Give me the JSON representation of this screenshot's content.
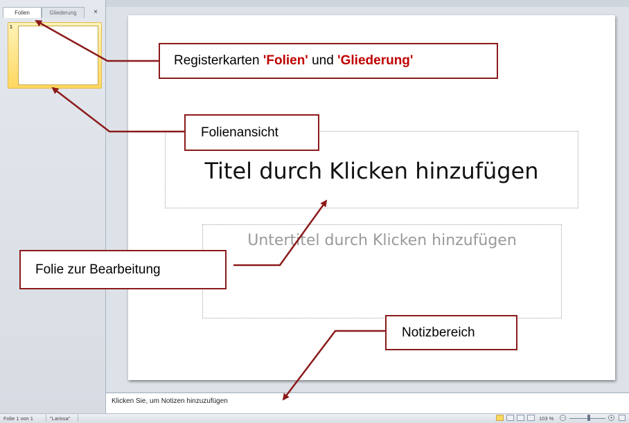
{
  "left_panel": {
    "tabs": [
      {
        "label": "Folien",
        "active": true
      },
      {
        "label": "Gliederung",
        "active": false
      }
    ],
    "close_glyph": "×",
    "slide_number": "1"
  },
  "slide": {
    "title_placeholder": "Titel durch Klicken hinzufügen",
    "subtitle_placeholder": "Untertitel durch Klicken hinzufügen"
  },
  "notes": {
    "placeholder": "Klicken Sie, um Notizen hinzuzufügen"
  },
  "statusbar": {
    "slide_info": "Folie 1 von 1",
    "theme": "\"Larissa\"",
    "zoom": "103 %",
    "zoom_minus": "−",
    "zoom_plus": "+",
    "zoom_level": 0.55
  },
  "callouts": {
    "tabs_prefix": "Registerkarten ",
    "tabs_folien": "'Folien'",
    "tabs_und": " und ",
    "tabs_gliederung": "'Gliederung'",
    "folienansicht": "Folienansicht",
    "bearbeitung": "Folie zur Bearbeitung",
    "notizbereich": "Notizbereich"
  },
  "colors": {
    "callout_border": "#8b1a1a",
    "arrow": "#8b1a1a",
    "highlight_text": "#c00000",
    "thumbnail_selected": "#ffd860"
  }
}
